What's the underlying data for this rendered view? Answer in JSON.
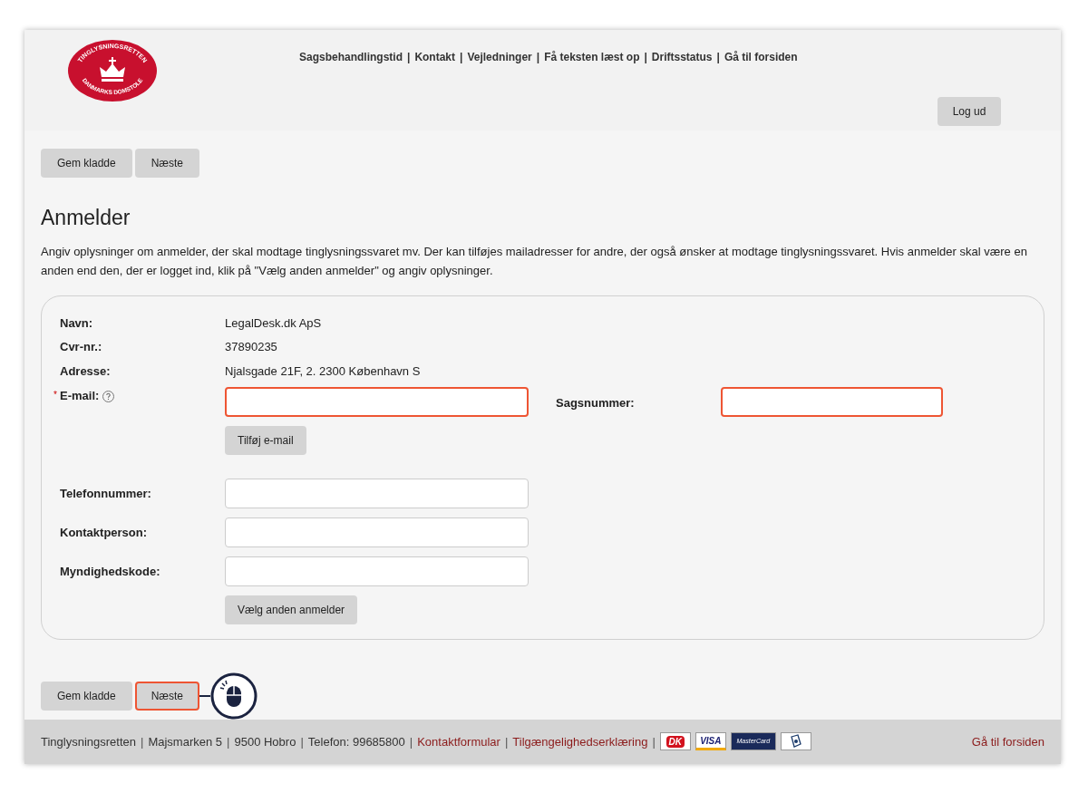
{
  "logo": {
    "top_text": "TINGLYSNINGSRETTEN",
    "bottom_text": "DANMARKS DOMSTOLE"
  },
  "top_nav": {
    "separator": "|",
    "links": [
      "Sagsbehandlingstid",
      "Kontakt",
      "Vejledninger",
      "Få teksten læst op",
      "Driftsstatus",
      "Gå til forsiden"
    ]
  },
  "logout_button": "Log ud",
  "top_buttons": [
    {
      "label": "Gem kladde",
      "highlighted": false
    },
    {
      "label": "Næste",
      "highlighted": false
    }
  ],
  "heading": "Anmelder",
  "intro": "Angiv oplysninger om anmelder, der skal modtage tinglysningssvaret mv. Der kan tilføjes mailadresser for andre, der også ønsker at modtage tinglysningssvaret. Hvis anmelder skal være en anden end den, der er logget ind, klik på \"Vælg anden anmelder\" og angiv oplysninger.",
  "info_rows": [
    {
      "label": "Navn:",
      "value": "LegalDesk.dk ApS"
    },
    {
      "label": "Cvr-nr.:",
      "value": "37890235"
    },
    {
      "label": "Adresse:",
      "value": "Njalsgade 21F, 2. 2300 København S"
    }
  ],
  "email": {
    "label": "E-mail:",
    "required": true,
    "required_marker": "*",
    "highlighted": true,
    "add_button": "Tilføj e-mail"
  },
  "case_number": {
    "label": "Sagsnummer:",
    "highlighted": true
  },
  "contact_fields": [
    {
      "label": "Telefonnummer:"
    },
    {
      "label": "Kontaktperson:"
    },
    {
      "label": "Myndighedskode:"
    }
  ],
  "choose_button": "Vælg anden anmelder",
  "bottom_buttons": [
    {
      "label": "Gem kladde",
      "highlighted": false
    },
    {
      "label": "Næste",
      "highlighted": true
    }
  ],
  "footer": {
    "separator": "|",
    "items": [
      {
        "text": "Tinglysningsretten",
        "kind": "text"
      },
      {
        "text": "Majsmarken 5",
        "kind": "text"
      },
      {
        "text": "9500 Hobro",
        "kind": "text"
      },
      {
        "text": "Telefon: 99685800",
        "kind": "text"
      },
      {
        "text": "Kontaktformular",
        "kind": "link"
      },
      {
        "text": "Tilgængelighedserklæring",
        "kind": "link"
      }
    ],
    "cards": [
      {
        "text": "DK",
        "kind": "dankort"
      },
      {
        "text": "VISA",
        "kind": "visa"
      },
      {
        "text": "MasterCard",
        "kind": "mastercard"
      },
      {
        "kind": "shield"
      }
    ],
    "home_link": "Gå til forsiden"
  }
}
